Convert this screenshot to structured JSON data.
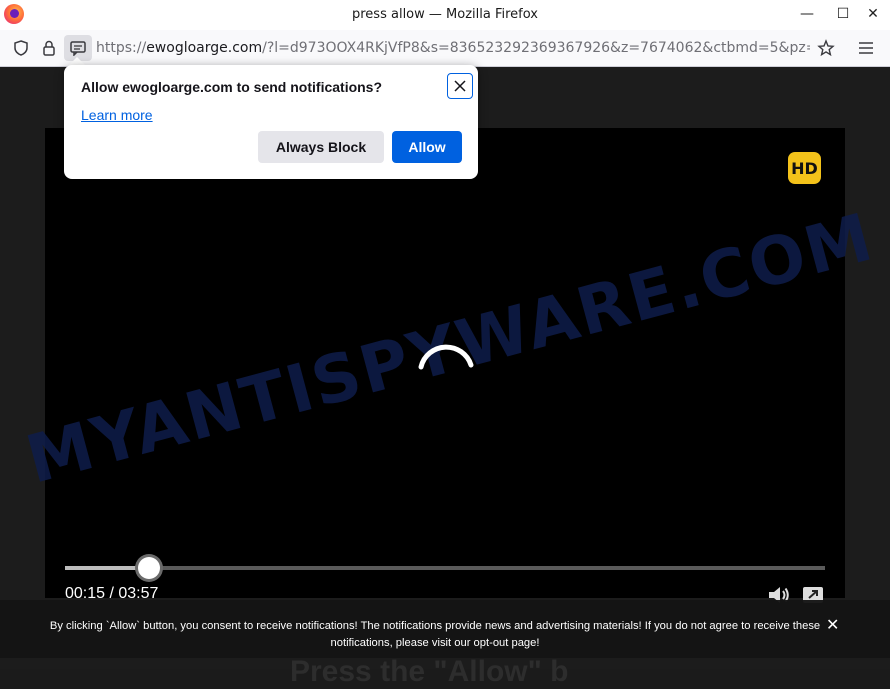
{
  "window": {
    "title": "press allow — Mozilla Firefox",
    "minimize_glyph": "—",
    "maximize_glyph": "☐",
    "close_glyph": "✕"
  },
  "navbar": {
    "url_prefix": "https://",
    "url_host": "ewogloarge.com",
    "url_path": "/?l=d973OOX4RKjVfP8&s=836523292369367926&z=7674062&ctbmd=5&pz="
  },
  "popup": {
    "message": "Allow ewogloarge.com to send notifications?",
    "learn_more": "Learn more",
    "block_label": "Always Block",
    "allow_label": "Allow"
  },
  "player": {
    "hd_badge": "HD",
    "time": "00:15 / 03:57",
    "progress_fraction": 0.11
  },
  "watermark": "MYANTISPYWARE.COM",
  "consent": {
    "text": "By clicking `Allow` button, you consent to receive notifications! The notifications provide news and advertising materials! If you do not agree to receive these notifications, please visit our opt-out page!",
    "close_glyph": "✕"
  },
  "bottom_text": "Press the \"Allow\" b",
  "colors": {
    "accent": "#0061e0",
    "hd_badge": "#f3c21a",
    "player_bg": "#000000"
  },
  "icons": [
    "firefox-logo",
    "shield-icon",
    "lock-icon",
    "notification-permission-icon",
    "star-icon",
    "menu-icon",
    "close-icon",
    "spinner-icon",
    "volume-icon",
    "fullscreen-icon"
  ]
}
